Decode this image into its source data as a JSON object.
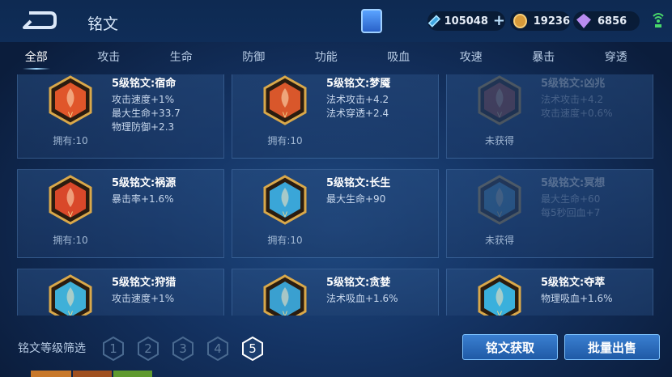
{
  "header": {
    "title": "铭文",
    "back_icon": "back-arrow-icon",
    "currencies": [
      {
        "icon": "ticket-icon",
        "value": "105048"
      },
      {
        "icon": "gold-coin-icon",
        "value": "19236"
      },
      {
        "icon": "gem-icon",
        "value": "6856"
      }
    ],
    "plus_label": "+"
  },
  "tabs": [
    "全部",
    "攻击",
    "生命",
    "防御",
    "功能",
    "吸血",
    "攻速",
    "暴击",
    "穿透"
  ],
  "cards": [
    {
      "name": "5级铭文:宿命",
      "attrs": [
        "攻击速度+1%",
        "最大生命+33.7",
        "物理防御+2.3"
      ],
      "status": "拥有:10",
      "locked": false,
      "color": "#e0562a"
    },
    {
      "name": "5级铭文:梦魇",
      "attrs": [
        "法术攻击+4.2",
        "法术穿透+2.4"
      ],
      "status": "拥有:10",
      "locked": false,
      "color": "#d9572b"
    },
    {
      "name": "5级铭文:凶兆",
      "attrs": [
        "法术攻击+4.2",
        "攻击速度+0.6%"
      ],
      "status": "未获得",
      "locked": true,
      "color": "#b04a3a"
    },
    {
      "name": "5级铭文:祸源",
      "attrs": [
        "暴击率+1.6%"
      ],
      "status": "拥有:10",
      "locked": false,
      "color": "#d9482a"
    },
    {
      "name": "5级铭文:长生",
      "attrs": [
        "最大生命+90"
      ],
      "status": "拥有:10",
      "locked": false,
      "color": "#3aa6d8"
    },
    {
      "name": "5级铭文:冥想",
      "attrs": [
        "最大生命+60",
        "每5秒回血+7"
      ],
      "status": "未获得",
      "locked": true,
      "color": "#4a8fb8"
    },
    {
      "name": "5级铭文:狩猎",
      "attrs": [
        "攻击速度+1%"
      ],
      "status": "",
      "locked": false,
      "color": "#3fb0d8"
    },
    {
      "name": "5级铭文:贪婪",
      "attrs": [
        "法术吸血+1.6%"
      ],
      "status": "",
      "locked": false,
      "color": "#3aa0d0"
    },
    {
      "name": "5级铭文:夺萃",
      "attrs": [
        "物理吸血+1.6%"
      ],
      "status": "",
      "locked": false,
      "color": "#3ab0dc"
    }
  ],
  "footer": {
    "filter_label": "铭文等级筛选",
    "levels": [
      "1",
      "2",
      "3",
      "4",
      "5"
    ],
    "active_level": "5",
    "obtain_button": "铭文获取",
    "sell_button": "批量出售"
  },
  "colors": {
    "accent": "#3a7fd1",
    "background": "#0b1d3c"
  }
}
